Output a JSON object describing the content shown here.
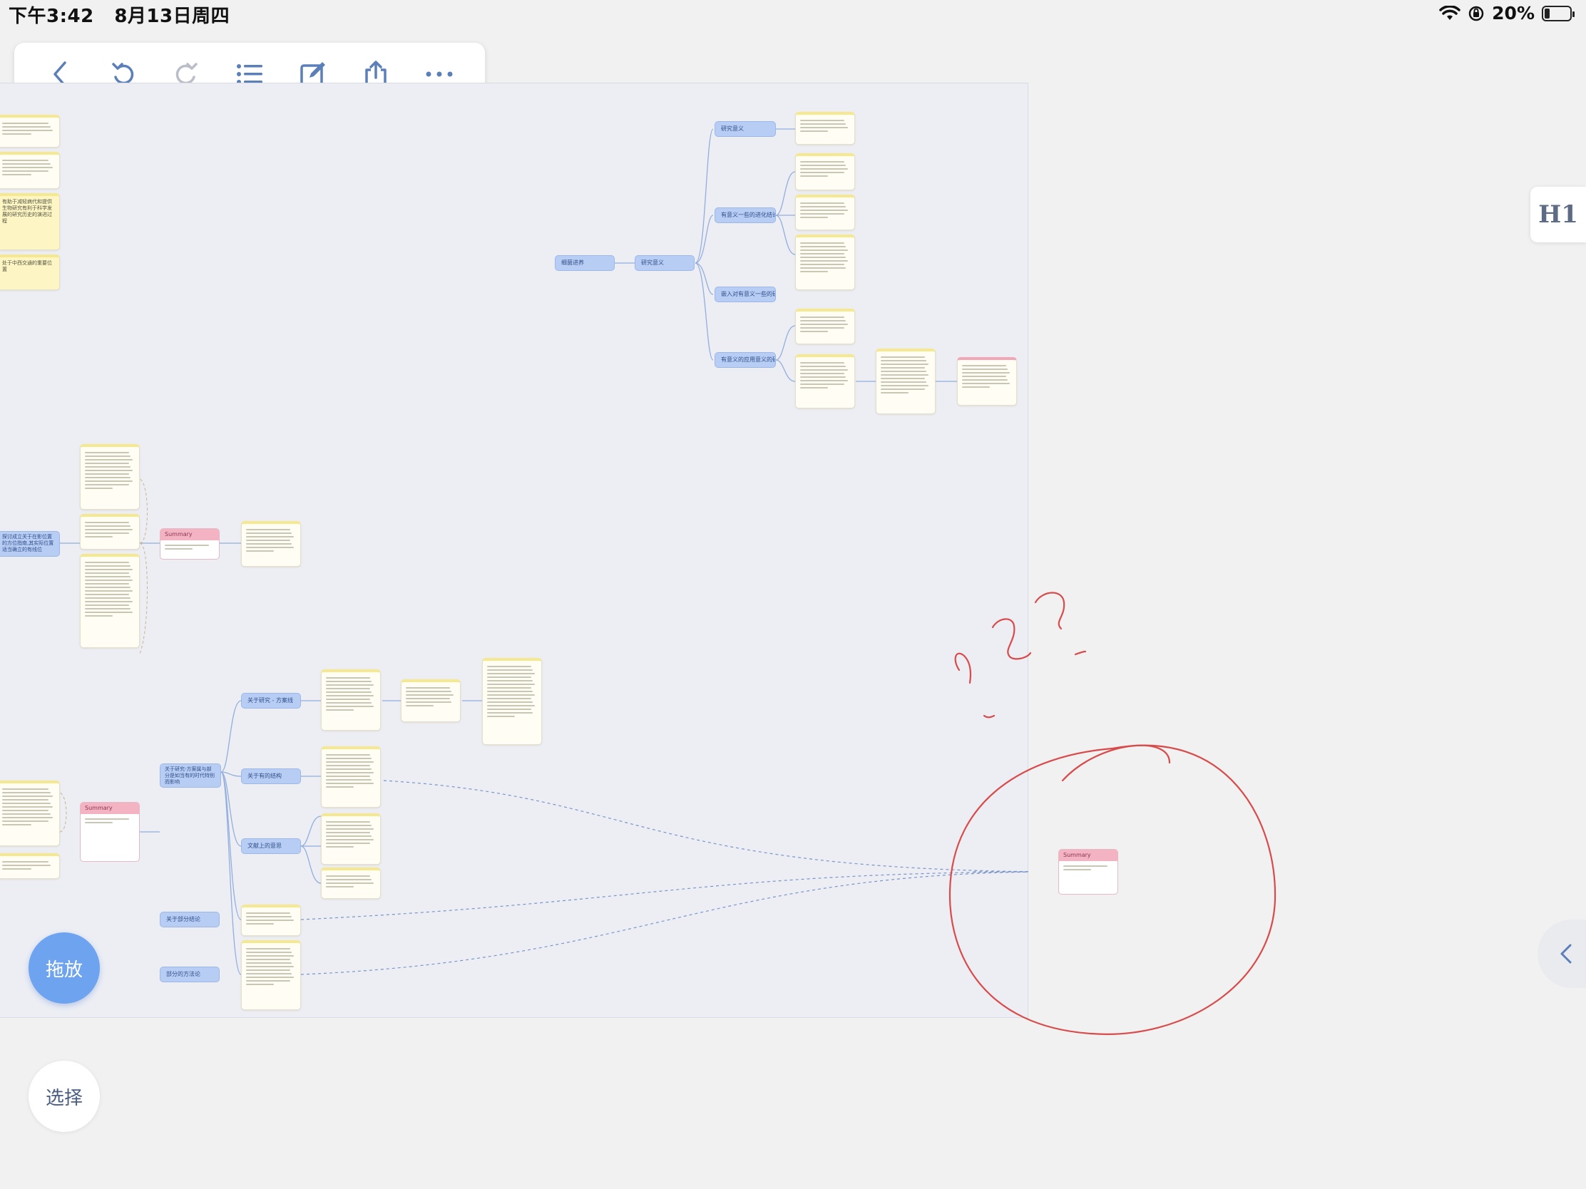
{
  "status_bar": {
    "time": "下午3:42",
    "date": "8月13日周四",
    "battery": "20%",
    "battery_level": 0.2
  },
  "toolbar": {
    "buttons": [
      {
        "name": "back-button",
        "icon": "chevron-left-icon"
      },
      {
        "name": "undo-button",
        "icon": "undo-icon"
      },
      {
        "name": "redo-button",
        "icon": "redo-icon"
      },
      {
        "name": "outline-button",
        "icon": "list-icon"
      },
      {
        "name": "edit-button",
        "icon": "edit-icon"
      },
      {
        "name": "share-button",
        "icon": "share-icon"
      },
      {
        "name": "more-button",
        "icon": "more-icon"
      }
    ]
  },
  "mindmap": {
    "root_1": "细菌进养",
    "child_1": "研究意义",
    "branches_1": [
      "研究意义",
      "有意义一些的进化结论",
      "嵌入对有意义一些的研究",
      "有意义的应用意义的研究"
    ],
    "left_topic": "探讨成立关于在影位置的方位指南,其实际位置适当确立的有线位",
    "summary_label": "Summary",
    "bottom_topic": "关于研究-方案属与部分是如当有的时代特别而影响",
    "bottom_branches": [
      "关于研究 - 方案线",
      "关于有的结构",
      "文献上的意思",
      "关于部分结论",
      "部分的方法论"
    ],
    "left_yellow_notes": [
      "有助于减轻病代和提供生物研究有利于科学发展的研究历史的演进过程",
      "处于中西交通的重要位置"
    ]
  },
  "side": {
    "h1_label": "H1",
    "collapse_icon": "chevron-left-icon"
  },
  "floating": {
    "drag_label": "拖放",
    "select_label": "选择"
  },
  "colors": {
    "topic": "#b8cdf3",
    "note_border": "#f6e88e",
    "summary": "#f3b3c2",
    "ink": "#d94b4b",
    "drag_button": "#6ea3f0"
  }
}
